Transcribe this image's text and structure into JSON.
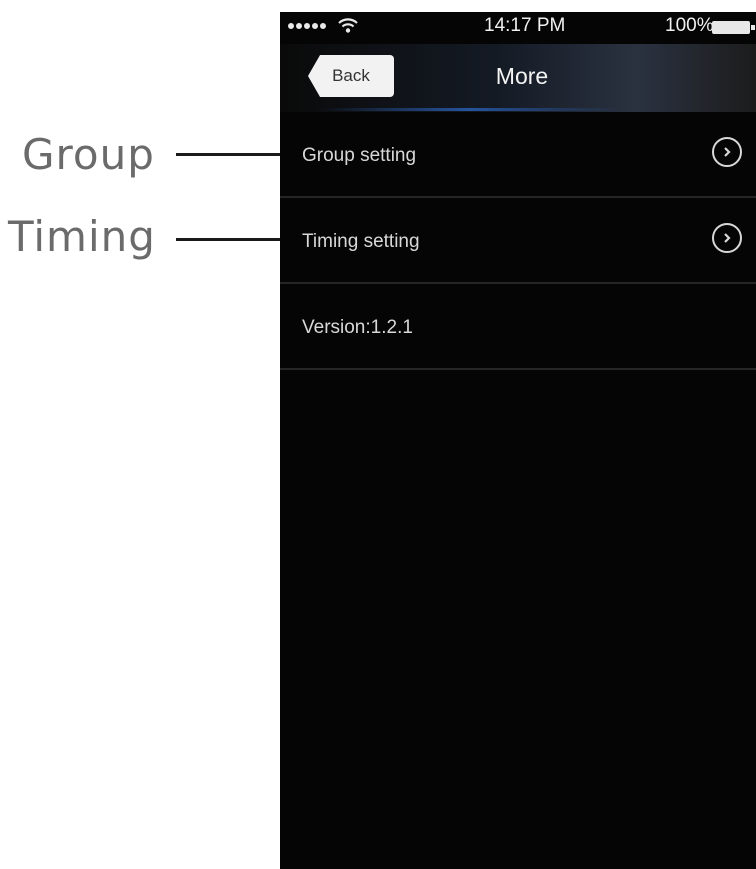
{
  "callouts": {
    "group": "Group",
    "timing": "Timing"
  },
  "statusbar": {
    "time": "14:17 PM",
    "battery": "100%"
  },
  "navbar": {
    "back_label": "Back",
    "title": "More"
  },
  "menu": {
    "items": [
      {
        "label": "Group setting",
        "icon": "chevron-right-circle-icon"
      },
      {
        "label": "Timing setting",
        "icon": "chevron-right-circle-icon"
      }
    ],
    "version": "Version:1.2.1"
  }
}
